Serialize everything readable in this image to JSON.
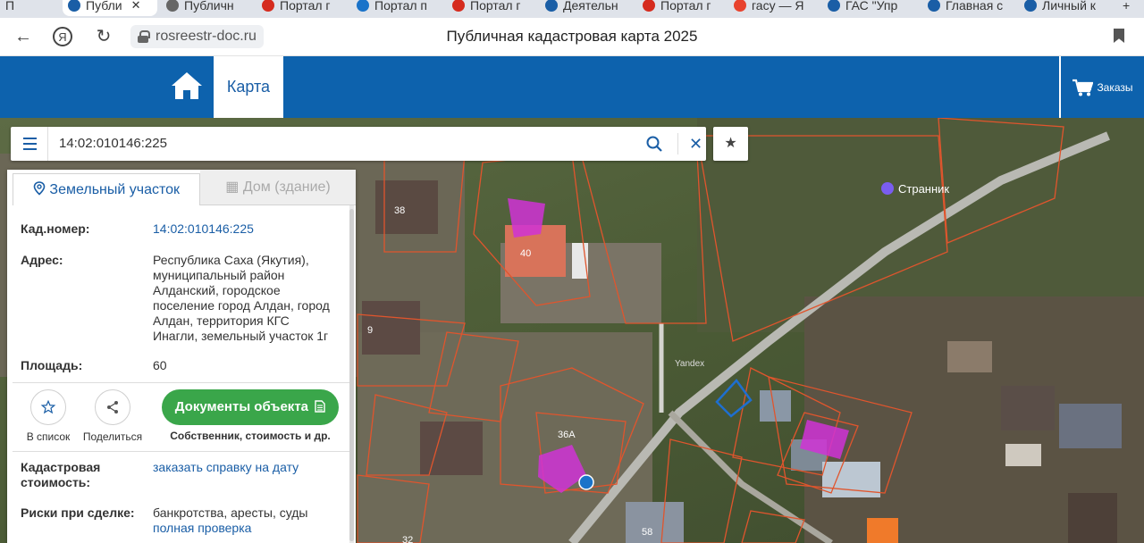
{
  "browser": {
    "tabs": [
      {
        "label": "П",
        "color": "#dfe3ea"
      },
      {
        "label": "Публи",
        "color": "#1a5ea6",
        "active": true
      },
      {
        "label": "Публичн",
        "color": "#666666"
      },
      {
        "label": "Портал г",
        "color": "#d52b1e"
      },
      {
        "label": "Портал п",
        "color": "#1a73c9"
      },
      {
        "label": "Портал г",
        "color": "#d52b1e"
      },
      {
        "label": "Деятельн",
        "color": "#1a5ea6"
      },
      {
        "label": "Портал г",
        "color": "#d52b1e"
      },
      {
        "label": "гасу — Я",
        "color": "#e8432e"
      },
      {
        "label": "ГАС \"Упр",
        "color": "#1a5ea6"
      },
      {
        "label": "Главная с",
        "color": "#1a5ea6"
      },
      {
        "label": "Личный к",
        "color": "#1a5ea6"
      }
    ],
    "tab_close": "✕",
    "new_tab": "+",
    "url": "rosreestr-doc.ru",
    "page_title": "Публичная кадастровая карта 2025"
  },
  "header": {
    "map_tab": "Карта",
    "orders": "Заказы"
  },
  "search": {
    "query": "14:02:010146:225"
  },
  "panel": {
    "tab_land": "Земельный участок",
    "tab_building": "Дом (здание)",
    "fields": {
      "cad_label": "Кад.номер:",
      "cad_value": "14:02:010146:225",
      "address_label": "Адрес:",
      "address_value": "Республика Саха (Якутия), муниципальный район Алданский, городское поселение город Алдан, город Алдан, территория КГС Инагли, земельный участок 1г",
      "area_label": "Площадь:",
      "area_value": "60",
      "cost_label_1": "Кадастровая",
      "cost_label_2": "стоимость:",
      "cost_value": "заказать справку на дату",
      "risk_label": "Риски при сделке:",
      "risk_value": "банкротства, аресты, суды",
      "risk_link": "полная проверка"
    },
    "actions": {
      "add_to_list": "В список",
      "share": "Поделиться",
      "docs_button": "Документы объекта",
      "docs_sub": "Собственник, стоимость и др."
    }
  },
  "map": {
    "labels": {
      "poi": "Странник",
      "n38": "38",
      "n40": "40",
      "n9": "9",
      "n36a": "36А",
      "n58": "58",
      "n32": "32",
      "yandex": "Yandex"
    },
    "colors": {
      "parcel_line": "#e0552d",
      "selected_parcel": "#1e6fd0",
      "highlight": "#d033d6",
      "road": "#b9b9b3"
    }
  }
}
